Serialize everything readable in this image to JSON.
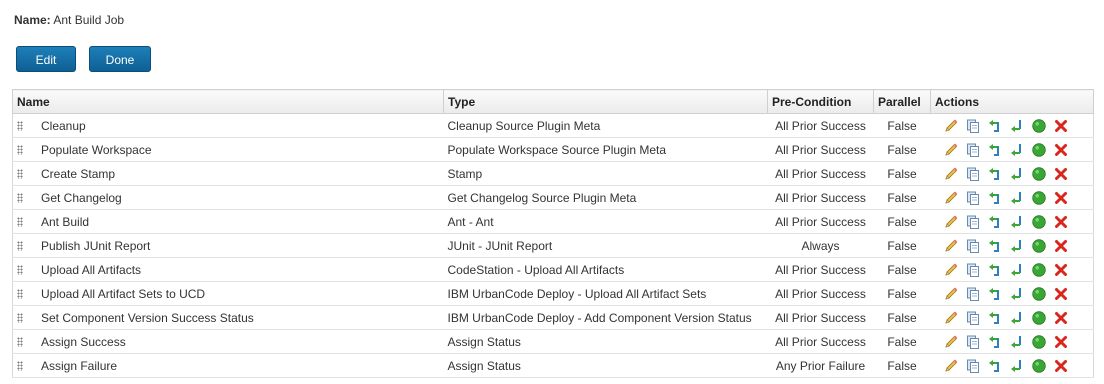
{
  "job": {
    "name_label": "Name:",
    "name_value": "Ant Build Job"
  },
  "buttons": {
    "edit": "Edit",
    "done": "Done"
  },
  "table": {
    "headers": {
      "name": "Name",
      "type": "Type",
      "precondition": "Pre-Condition",
      "parallel": "Parallel",
      "actions": "Actions"
    },
    "rows": [
      {
        "name": "Cleanup",
        "type": "Cleanup Source Plugin Meta",
        "precondition": "All Prior Success",
        "parallel": "False"
      },
      {
        "name": "Populate Workspace",
        "type": "Populate Workspace Source Plugin Meta",
        "precondition": "All Prior Success",
        "parallel": "False"
      },
      {
        "name": "Create Stamp",
        "type": "Stamp",
        "precondition": "All Prior Success",
        "parallel": "False"
      },
      {
        "name": "Get Changelog",
        "type": "Get Changelog Source Plugin Meta",
        "precondition": "All Prior Success",
        "parallel": "False"
      },
      {
        "name": "Ant Build",
        "type": "Ant - Ant",
        "precondition": "All Prior Success",
        "parallel": "False"
      },
      {
        "name": "Publish JUnit Report",
        "type": "JUnit - JUnit Report",
        "precondition": "Always",
        "parallel": "False"
      },
      {
        "name": "Upload All Artifacts",
        "type": "CodeStation - Upload All Artifacts",
        "precondition": "All Prior Success",
        "parallel": "False"
      },
      {
        "name": "Upload All Artifact Sets to UCD",
        "type": "IBM UrbanCode Deploy - Upload All Artifact Sets",
        "precondition": "All Prior Success",
        "parallel": "False"
      },
      {
        "name": "Set Component Version Success Status",
        "type": "IBM UrbanCode Deploy - Add Component Version Status",
        "precondition": "All Prior Success",
        "parallel": "False"
      },
      {
        "name": "Assign Success",
        "type": "Assign Status",
        "precondition": "All Prior Success",
        "parallel": "False"
      },
      {
        "name": "Assign Failure",
        "type": "Assign Status",
        "precondition": "Any Prior Failure",
        "parallel": "False"
      }
    ],
    "action_icons": [
      "pencil-icon",
      "copy-icon",
      "insert-before-icon",
      "insert-after-icon",
      "green-circle-icon",
      "red-x-icon"
    ]
  },
  "colors": {
    "button_blue": "#1668a3",
    "pencil": "#e8b23a",
    "green": "#3aa735",
    "red": "#d9251c"
  }
}
